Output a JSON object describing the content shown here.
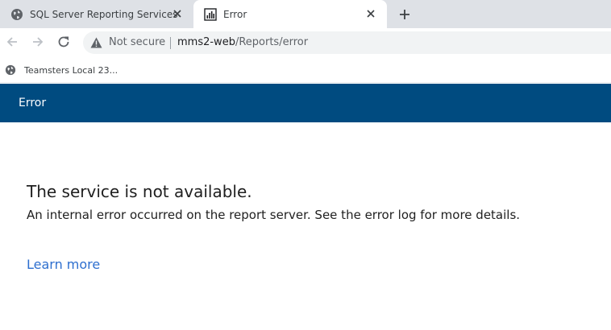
{
  "browser": {
    "tabs": [
      {
        "title": "SQL Server Reporting Services",
        "favicon": "globe-icon",
        "active": false
      },
      {
        "title": "Error",
        "favicon": "report-chart-icon",
        "active": true
      }
    ],
    "new_tab_icon": "plus-icon",
    "close_icon": "close-icon",
    "security_label": "Not secure",
    "url_host": "mms2-web",
    "url_path": "/Reports/error",
    "bookmarks": [
      {
        "label": "Teamsters Local 23...",
        "icon": "globe-icon"
      }
    ]
  },
  "page": {
    "header_title": "Error",
    "header_color": "#004b80",
    "heading": "The service is not available.",
    "message": "An internal error occurred on the report server. See the error log for more details.",
    "learn_more": "Learn more",
    "link_color": "#2d6fcf"
  }
}
